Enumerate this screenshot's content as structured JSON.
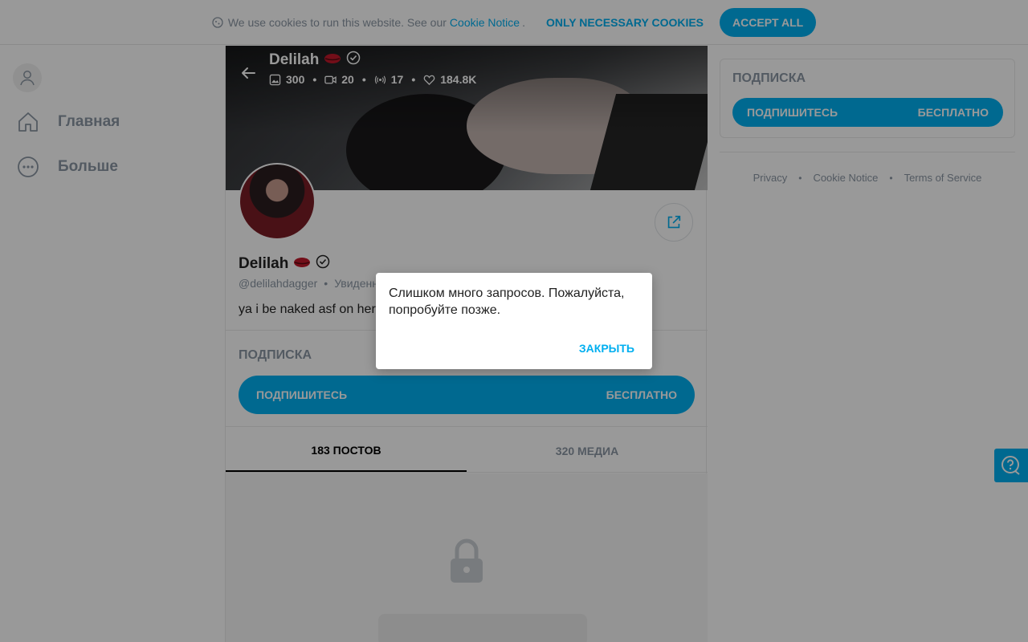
{
  "cookie_bar": {
    "text": "We use cookies to run this website. See our",
    "link": "Cookie Notice",
    "dot": ".",
    "necessary_label": "ONLY NECESSARY COOKIES",
    "accept_label": "ACCEPT ALL",
    "icon": "cookie-icon"
  },
  "sidebar": {
    "items": [
      {
        "label": "Главная",
        "icon": "home-icon"
      },
      {
        "label": "Больше",
        "icon": "more-icon"
      }
    ]
  },
  "profile": {
    "name": "Delilah",
    "stats": {
      "photos": "300",
      "videos": "20",
      "streams": "17",
      "likes": "184.8K"
    },
    "handle": "@delilahdagger",
    "meta_sep": "•",
    "meta_status": "Увиденн",
    "bio": "ya i be naked asf on here"
  },
  "subscription": {
    "title": "ПОДПИСКА",
    "button_label": "ПОДПИШИТЕСЬ",
    "price": "БЕСПЛАТНО"
  },
  "tabs": [
    {
      "label": "183 ПОСТОВ",
      "active": true
    },
    {
      "label": "320 МЕДИА",
      "active": false
    }
  ],
  "right_panel": {
    "title": "ПОДПИСКА",
    "button_label": "ПОДПИШИТЕСЬ",
    "price": "БЕСПЛАТНО",
    "footer_links": [
      "Privacy",
      "Cookie Notice",
      "Terms of Service"
    ]
  },
  "modal": {
    "message": "Слишком много запросов. Пожалуйста, попробуйте позже.",
    "close_label": "ЗАКРЫТЬ"
  },
  "colors": {
    "accent": "#00aff0",
    "muted": "#8a96a3",
    "overlay": "rgba(0,0,0,0.4)"
  }
}
